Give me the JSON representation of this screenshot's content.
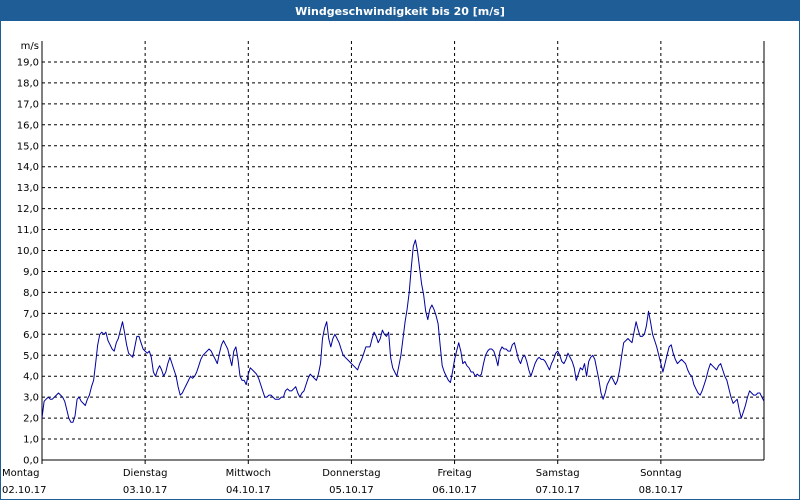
{
  "window": {
    "title": "Windgeschwindigkeit bis 20 [m/s]"
  },
  "colors": {
    "title_bar": "#1f5d96",
    "line": "#0000a0",
    "grid": "#000000",
    "axis": "#000000"
  },
  "chart_data": {
    "type": "line",
    "title": "Windgeschwindigkeit bis 20 [m/s]",
    "ylabel": "m/s",
    "ylim": [
      0,
      20
    ],
    "y_ticks": [
      "0,0",
      "1,0",
      "2,0",
      "3,0",
      "4,0",
      "5,0",
      "6,0",
      "7,0",
      "8,0",
      "9,0",
      "10,0",
      "11,0",
      "12,0",
      "13,0",
      "14,0",
      "15,0",
      "16,0",
      "17,0",
      "18,0",
      "19,0"
    ],
    "x_categories": [
      {
        "day": "Montag",
        "date": "02.10.17"
      },
      {
        "day": "Dienstag",
        "date": "03.10.17"
      },
      {
        "day": "Mittwoch",
        "date": "04.10.17"
      },
      {
        "day": "Donnerstag",
        "date": "05.10.17"
      },
      {
        "day": "Freitag",
        "date": "06.10.17"
      },
      {
        "day": "Samstag",
        "date": "07.10.17"
      },
      {
        "day": "Sonntag",
        "date": "08.10.17"
      }
    ],
    "xlim_days": [
      0,
      7.0
    ],
    "grid": true,
    "series": [
      {
        "x_days": [
          0,
          0.02,
          0.04,
          0.06,
          0.08,
          0.1,
          0.12,
          0.14,
          0.16,
          0.18,
          0.2,
          0.22,
          0.24,
          0.26,
          0.28,
          0.3,
          0.32,
          0.34,
          0.36,
          0.38,
          0.4,
          0.42,
          0.44,
          0.46,
          0.48,
          0.5,
          0.52,
          0.54,
          0.56,
          0.58,
          0.6,
          0.62,
          0.64,
          0.66,
          0.68,
          0.7,
          0.72,
          0.74,
          0.76,
          0.78,
          0.8,
          0.82,
          0.84,
          0.86,
          0.88,
          0.9,
          0.92,
          0.94,
          0.96,
          0.98,
          1.0,
          1.02,
          1.04,
          1.06,
          1.08,
          1.1,
          1.12,
          1.14,
          1.16,
          1.18,
          1.2,
          1.22,
          1.24,
          1.26,
          1.28,
          1.3,
          1.32,
          1.34,
          1.36,
          1.38,
          1.4,
          1.42,
          1.44,
          1.46,
          1.48,
          1.5,
          1.52,
          1.54,
          1.56,
          1.58,
          1.6,
          1.62,
          1.64,
          1.66,
          1.68,
          1.7,
          1.72,
          1.74,
          1.76,
          1.78,
          1.8,
          1.82,
          1.84,
          1.86,
          1.88,
          1.9,
          1.92,
          1.94,
          1.96,
          1.98,
          2.0,
          2.02,
          2.04,
          2.06,
          2.08,
          2.1,
          2.12,
          2.14,
          2.16,
          2.18,
          2.2,
          2.22,
          2.24,
          2.26,
          2.28,
          2.3,
          2.32,
          2.34,
          2.36,
          2.38,
          2.4,
          2.42,
          2.44,
          2.46,
          2.48,
          2.5,
          2.52,
          2.54,
          2.56,
          2.58,
          2.6,
          2.62,
          2.64,
          2.66,
          2.68,
          2.7,
          2.72,
          2.74,
          2.76,
          2.78,
          2.8,
          2.82,
          2.84,
          2.86,
          2.88,
          2.9,
          2.92,
          2.94,
          2.96,
          2.98,
          3.0,
          3.02,
          3.04,
          3.06,
          3.08,
          3.1,
          3.12,
          3.14,
          3.16,
          3.18,
          3.2,
          3.22,
          3.24,
          3.26,
          3.28,
          3.3,
          3.32,
          3.34,
          3.36,
          3.38,
          3.4,
          3.42,
          3.44,
          3.46,
          3.48,
          3.5,
          3.52,
          3.54,
          3.56,
          3.58,
          3.6,
          3.62,
          3.64,
          3.66,
          3.68,
          3.7,
          3.72,
          3.74,
          3.76,
          3.78,
          3.8,
          3.82,
          3.84,
          3.86,
          3.88,
          3.9,
          3.92,
          3.94,
          3.96,
          3.98,
          4.0,
          4.02,
          4.04,
          4.06,
          4.08,
          4.1,
          4.12,
          4.14,
          4.16,
          4.18,
          4.2,
          4.22,
          4.24,
          4.26,
          4.28,
          4.3,
          4.32,
          4.34,
          4.36,
          4.38,
          4.4,
          4.42,
          4.44,
          4.46,
          4.48,
          4.5,
          4.52,
          4.54,
          4.56,
          4.58,
          4.6,
          4.62,
          4.64,
          4.66,
          4.68,
          4.7,
          4.72,
          4.74,
          4.76,
          4.78,
          4.8,
          4.82,
          4.84,
          4.86,
          4.88,
          4.9,
          4.92,
          4.94,
          4.96,
          4.98,
          5.0,
          5.02,
          5.04,
          5.06,
          5.08,
          5.1,
          5.12,
          5.14,
          5.16,
          5.18,
          5.2,
          5.22,
          5.24,
          5.26,
          5.28,
          5.3,
          5.32,
          5.34,
          5.36,
          5.38,
          5.4,
          5.42,
          5.44,
          5.46,
          5.48,
          5.5,
          5.52,
          5.54,
          5.56,
          5.58,
          5.6,
          5.62,
          5.64,
          5.66,
          5.68,
          5.7,
          5.72,
          5.74,
          5.76,
          5.78,
          5.8,
          5.82,
          5.84,
          5.86,
          5.88,
          5.9,
          5.92,
          5.94,
          5.96,
          5.98,
          6.0,
          6.02,
          6.04,
          6.06,
          6.08,
          6.1,
          6.12,
          6.14,
          6.16,
          6.18,
          6.2,
          6.22,
          6.24,
          6.26,
          6.28,
          6.3,
          6.32,
          6.34,
          6.36,
          6.38,
          6.4,
          6.42,
          6.44,
          6.46,
          6.48,
          6.5,
          6.52,
          6.54,
          6.56,
          6.58,
          6.6,
          6.62,
          6.64,
          6.66,
          6.68,
          6.7,
          6.72,
          6.74,
          6.76,
          6.78,
          6.8,
          6.82,
          6.84,
          6.86,
          6.88,
          6.9,
          6.92,
          6.94,
          6.96,
          6.98,
          7.0
        ],
        "values": [
          2.0,
          2.8,
          2.9,
          3.0,
          2.9,
          2.9,
          3.0,
          3.1,
          3.2,
          3.1,
          3.0,
          2.8,
          2.4,
          2.0,
          1.8,
          1.8,
          2.1,
          2.9,
          3.0,
          2.8,
          2.7,
          2.6,
          2.9,
          3.1,
          3.5,
          3.8,
          4.6,
          5.5,
          6.0,
          6.1,
          6.0,
          6.1,
          5.7,
          5.5,
          5.3,
          5.2,
          5.6,
          5.8,
          6.2,
          6.6,
          6.1,
          5.5,
          5.1,
          5.0,
          4.9,
          5.4,
          5.9,
          5.9,
          5.6,
          5.3,
          5.2,
          5.1,
          5.2,
          4.9,
          4.2,
          4.0,
          4.3,
          4.5,
          4.3,
          4.0,
          4.2,
          4.6,
          4.9,
          4.6,
          4.3,
          4.0,
          3.5,
          3.1,
          3.2,
          3.4,
          3.6,
          3.8,
          4.0,
          3.9,
          4.0,
          4.2,
          4.5,
          4.8,
          5.0,
          5.1,
          5.2,
          5.3,
          5.2,
          5.0,
          4.8,
          4.6,
          5.1,
          5.5,
          5.7,
          5.5,
          5.3,
          4.9,
          4.5,
          5.2,
          5.4,
          4.8,
          4.0,
          3.8,
          3.8,
          3.6,
          4.1,
          4.4,
          4.3,
          4.2,
          4.1,
          3.9,
          3.6,
          3.3,
          3.0,
          3.0,
          3.1,
          3.1,
          3.0,
          2.9,
          2.9,
          2.9,
          3.0,
          3.0,
          3.3,
          3.4,
          3.3,
          3.3,
          3.4,
          3.5,
          3.2,
          3.0,
          3.2,
          3.3,
          3.6,
          3.9,
          4.1,
          4.0,
          3.9,
          3.8,
          4.1,
          4.6,
          5.8,
          6.3,
          6.6,
          5.8,
          5.4,
          5.8,
          6.0,
          5.8,
          5.6,
          5.3,
          5.0,
          4.9,
          4.8,
          4.7,
          4.6,
          4.5,
          4.4,
          4.3,
          4.6,
          4.8,
          5.1,
          5.4,
          5.4,
          5.4,
          5.8,
          6.1,
          5.9,
          5.6,
          5.8,
          6.2,
          6.0,
          5.9,
          6.1,
          4.9,
          4.4,
          4.2,
          4.0,
          4.5,
          5.0,
          5.8,
          6.6,
          7.2,
          8.0,
          9.2,
          10.2,
          10.5,
          10.0,
          9.2,
          8.4,
          7.9,
          7.1,
          6.7,
          7.2,
          7.4,
          7.2,
          6.9,
          6.5,
          5.5,
          4.5,
          4.2,
          4.0,
          3.8,
          3.7,
          4.2,
          4.8,
          5.2,
          5.6,
          5.2,
          4.6,
          4.7,
          4.5,
          4.4,
          4.2,
          4.2,
          4.0,
          4.1,
          4.0,
          4.1,
          4.6,
          5.0,
          5.2,
          5.3,
          5.3,
          5.2,
          4.9,
          4.5,
          5.2,
          5.4,
          5.3,
          5.3,
          5.2,
          5.2,
          5.5,
          5.6,
          5.2,
          4.8,
          4.6,
          4.9,
          5.0,
          4.7,
          4.3,
          4.0,
          4.3,
          4.6,
          4.8,
          4.9,
          4.8,
          4.8,
          4.7,
          4.5,
          4.3,
          4.6,
          4.8,
          5.1,
          5.2,
          5.0,
          4.7,
          4.6,
          4.8,
          5.1,
          4.9,
          4.7,
          4.4,
          3.8,
          4.1,
          4.4,
          4.3,
          4.6,
          4.0,
          4.7,
          4.9,
          5.0,
          4.8,
          4.3,
          3.8,
          3.2,
          2.9,
          3.2,
          3.6,
          3.8,
          4.0,
          3.8,
          3.6,
          3.8,
          4.3,
          5.0,
          5.6,
          5.7,
          5.8,
          5.7,
          5.6,
          6.1,
          6.6,
          6.2,
          5.9,
          5.9,
          6.0,
          6.4,
          7.1,
          6.6,
          6.0,
          5.7,
          5.4,
          5.0,
          4.6,
          4.2,
          4.6,
          5.0,
          5.4,
          5.5,
          5.1,
          4.8,
          4.6,
          4.7,
          4.8,
          4.7,
          4.6,
          4.3,
          4.1,
          4.0,
          3.6,
          3.4,
          3.2,
          3.1,
          3.3,
          3.6,
          3.9,
          4.3,
          4.6,
          4.5,
          4.4,
          4.3,
          4.5,
          4.6,
          4.3,
          4.0,
          3.8,
          3.4,
          3.0,
          2.7,
          2.8,
          2.9,
          2.4,
          2.0,
          2.3,
          2.6,
          3.0,
          3.3,
          3.2,
          3.1,
          3.1,
          3.2,
          3.2,
          3.0,
          2.8,
          2.6,
          2.8,
          3.0,
          2.6,
          2.1
        ]
      }
    ]
  }
}
